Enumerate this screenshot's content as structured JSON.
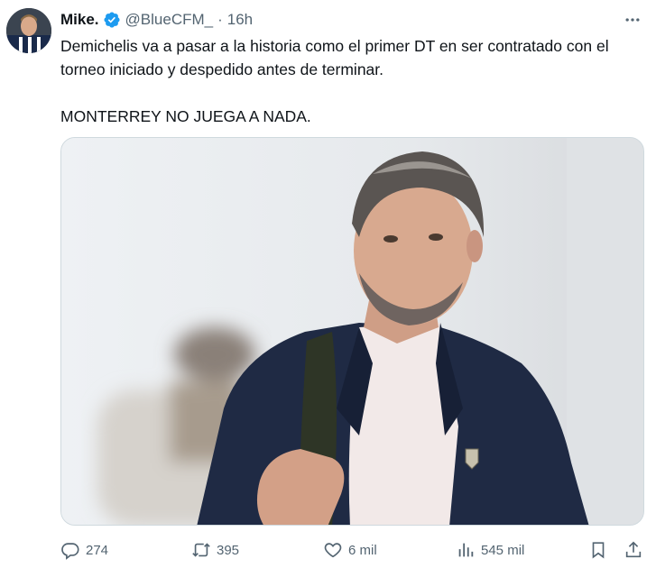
{
  "tweet": {
    "author_name": "Mike.",
    "author_handle": "@BlueCFM_",
    "separator": "·",
    "time": "16h",
    "text_line1": "Demichelis va a pasar a la historia como el primer DT en ser contratado con el torneo iniciado y despedido antes de terminar.",
    "text_line2": "MONTERREY NO JUEGA A NADA."
  },
  "actions": {
    "replies": "274",
    "retweets": "395",
    "likes": "6 mil",
    "views": "545 mil"
  },
  "icons": {
    "verified": "verified-badge-icon",
    "more": "more-options-icon",
    "reply": "reply-icon",
    "retweet": "retweet-icon",
    "like": "heart-icon",
    "views": "views-chart-icon",
    "bookmark": "bookmark-icon",
    "share": "share-icon"
  },
  "colors": {
    "text": "#0f1419",
    "secondary": "#536471",
    "verified": "#1d9bf0",
    "border": "#cfd9de"
  }
}
